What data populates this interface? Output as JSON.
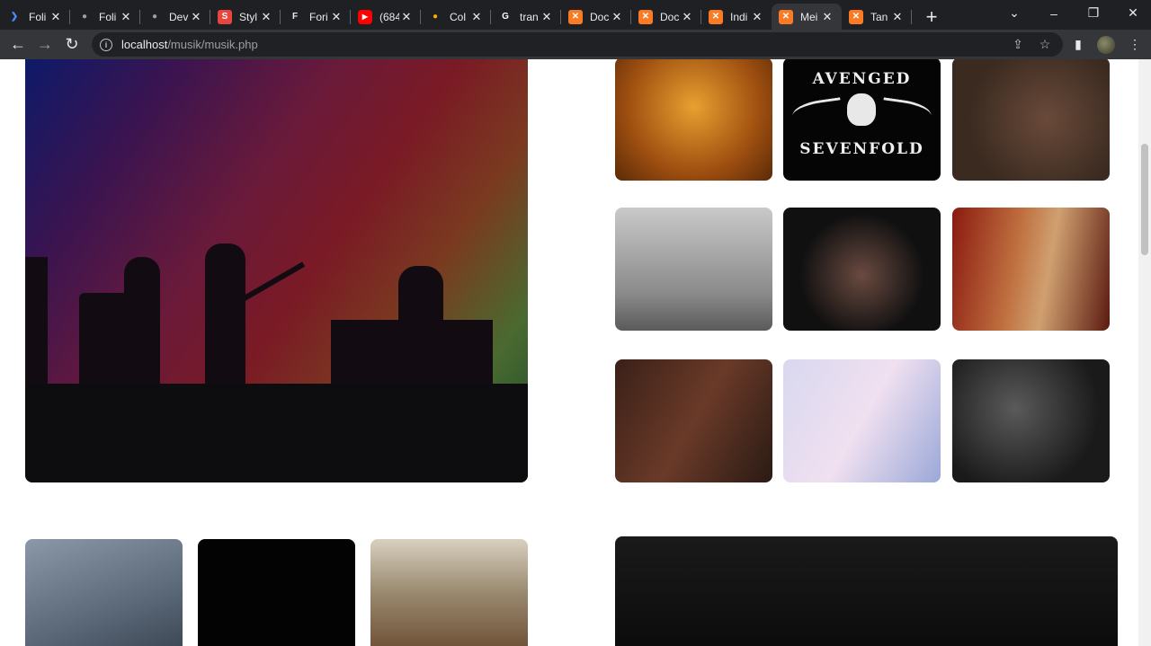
{
  "browser": {
    "tabs": [
      {
        "title": "Foli",
        "icon": "brand-icon",
        "color": "#4a8cff"
      },
      {
        "title": "Foli",
        "icon": "globe-icon",
        "color": "#9aa0a6"
      },
      {
        "title": "Dev",
        "icon": "globe-icon",
        "color": "#9aa0a6"
      },
      {
        "title": "Styl",
        "icon": "s-icon",
        "color": "#e8453c"
      },
      {
        "title": "Fori",
        "icon": "f-icon",
        "color": "#e8eaed"
      },
      {
        "title": "(684",
        "icon": "youtube-icon",
        "color": "#ff0000"
      },
      {
        "title": "Col",
        "icon": "colab-icon",
        "color": "#f9ab00"
      },
      {
        "title": "tran",
        "icon": "google-icon",
        "color": "#ffffff"
      },
      {
        "title": "Doc",
        "icon": "xampp-icon",
        "color": "#fb7a24"
      },
      {
        "title": "Doc",
        "icon": "xampp-icon",
        "color": "#fb7a24"
      },
      {
        "title": "Indi",
        "icon": "xampp-icon",
        "color": "#fb7a24"
      },
      {
        "title": "Mei",
        "icon": "xampp-icon",
        "color": "#fb7a24"
      },
      {
        "title": "Tan",
        "icon": "xampp-icon",
        "color": "#fb7a24"
      }
    ],
    "active_tab_index": 11,
    "url_host": "localhost",
    "url_path": "/musik/musik.php"
  },
  "gallery": {
    "a7x_top": "AVENGED",
    "a7x_bottom": "SEVENFOLD"
  }
}
